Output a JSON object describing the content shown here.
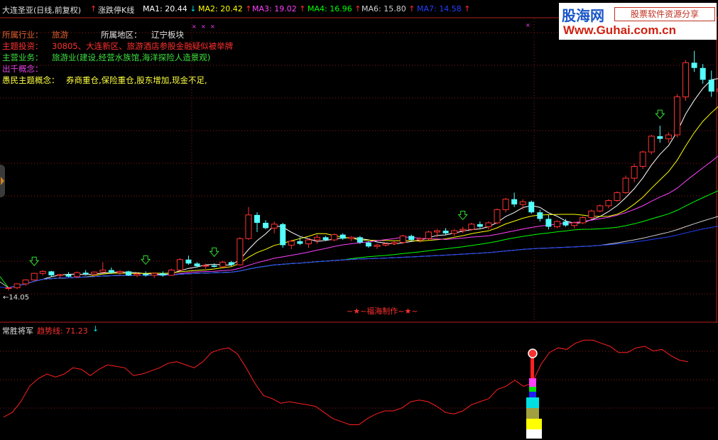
{
  "header": {
    "stock_title": "大连圣亚(日线,前复权)",
    "indicator_name": "涨跌停K线",
    "ma_items": [
      {
        "label": "MA1: 20.44",
        "arrow": "↓",
        "color": "#ffffff",
        "arrow_color": "#00e0e0"
      },
      {
        "label": "MA2: 20.42",
        "arrow": "↑",
        "color": "#ffff00",
        "arrow_color": "#ff3030"
      },
      {
        "label": "MA3: 19.02",
        "arrow": "↑",
        "color": "#ff40ff",
        "arrow_color": "#ff3030"
      },
      {
        "label": "MA4: 16.96",
        "arrow": "↑",
        "color": "#00ff00",
        "arrow_color": "#ff3030"
      },
      {
        "label": "MA6: 15.80",
        "arrow": "↑",
        "color": "#d0d0d0",
        "arrow_color": "#ff3030"
      },
      {
        "label": "MA7: 14.58",
        "arrow": "↑",
        "color": "#2040ff",
        "arrow_color": "#ff3030"
      }
    ]
  },
  "info": {
    "industry_label": "所属行业：",
    "industry_value": "旅游",
    "region_label": "所属地区：",
    "region_value": "辽宁板块",
    "theme_label": "主题投资：",
    "theme_value": "30805、大连新区、旅游酒店参股金融疑似被举牌",
    "business_label": "主营业务：",
    "business_value": "旅游业(建设,经营水族馆,海洋探险人造景观)",
    "concept_label": "出千概念：",
    "retail_label": "愚民主题概念：",
    "retail_value": "券商重仓,保险重仓,股东增加,现金不足,"
  },
  "low_price_label": "←14.05",
  "watermark": "~★~福海制作~★~",
  "indicator": {
    "name": "常胜将军",
    "trend_label": "趋势线: 71.23",
    "arrow": "↓"
  },
  "logo": {
    "cn": "股海网",
    "slogan": "股票软件资源分享",
    "url": "Www.Guhai.com.cn"
  },
  "colors": {
    "up": "#ff3232",
    "down": "#54ffff",
    "ma1": "#ffffff",
    "ma2": "#ffff00",
    "ma3": "#ff40ff",
    "ma4": "#00ff00",
    "ma6": "#d0d0d0",
    "ma7": "#2040ff",
    "trend": "#ff2020"
  },
  "chart_data": {
    "type": "candlestick",
    "price_low_marker": 14.05,
    "candles": [
      [
        14.2,
        14.3,
        14.05,
        14.25
      ],
      [
        14.25,
        14.6,
        14.15,
        14.55
      ],
      [
        14.55,
        14.9,
        14.4,
        14.85
      ],
      [
        14.85,
        15.4,
        14.8,
        15.35
      ],
      [
        15.35,
        15.6,
        15.2,
        15.5
      ],
      [
        15.5,
        15.55,
        15.1,
        15.2
      ],
      [
        15.2,
        15.3,
        15.0,
        15.25
      ],
      [
        15.25,
        15.45,
        15.05,
        15.1
      ],
      [
        15.1,
        15.5,
        15.0,
        15.4
      ],
      [
        15.4,
        15.6,
        15.2,
        15.3
      ],
      [
        15.3,
        15.5,
        15.1,
        15.45
      ],
      [
        15.45,
        16.2,
        15.4,
        15.6
      ],
      [
        15.6,
        15.8,
        15.3,
        15.4
      ],
      [
        15.4,
        15.6,
        15.2,
        15.5
      ],
      [
        15.5,
        15.55,
        15.15,
        15.2
      ],
      [
        15.2,
        15.4,
        15.05,
        15.3
      ],
      [
        15.3,
        15.5,
        15.1,
        15.2
      ],
      [
        15.2,
        15.4,
        15.0,
        15.35
      ],
      [
        15.35,
        15.5,
        15.1,
        15.2
      ],
      [
        15.2,
        15.7,
        15.15,
        15.6
      ],
      [
        15.6,
        16.5,
        15.5,
        16.4
      ],
      [
        16.4,
        16.7,
        16.0,
        16.1
      ],
      [
        16.1,
        16.2,
        15.8,
        15.9
      ],
      [
        15.9,
        16.1,
        15.7,
        15.95
      ],
      [
        15.95,
        16.1,
        15.8,
        15.85
      ],
      [
        15.85,
        16.3,
        15.8,
        16.2
      ],
      [
        16.2,
        16.3,
        15.9,
        16.0
      ],
      [
        16.0,
        18.1,
        15.95,
        18.0
      ],
      [
        18.0,
        20.4,
        17.9,
        19.8
      ],
      [
        19.8,
        20.0,
        18.5,
        19.2
      ],
      [
        19.2,
        19.4,
        18.7,
        18.8
      ],
      [
        18.8,
        19.3,
        18.4,
        19.1
      ],
      [
        19.1,
        19.2,
        17.3,
        17.5
      ],
      [
        17.5,
        17.9,
        17.2,
        17.8
      ],
      [
        17.8,
        18.1,
        17.5,
        17.6
      ],
      [
        17.6,
        18.0,
        17.3,
        17.9
      ],
      [
        17.9,
        18.3,
        17.6,
        18.1
      ],
      [
        18.1,
        18.2,
        17.8,
        17.9
      ],
      [
        17.9,
        18.4,
        17.8,
        18.3
      ],
      [
        18.3,
        18.4,
        17.9,
        18.0
      ],
      [
        18.0,
        18.2,
        17.8,
        18.1
      ],
      [
        18.1,
        18.2,
        17.6,
        17.7
      ],
      [
        17.7,
        17.8,
        17.3,
        17.4
      ],
      [
        17.4,
        17.6,
        17.2,
        17.5
      ],
      [
        17.5,
        17.7,
        17.4,
        17.6
      ],
      [
        17.6,
        17.8,
        17.5,
        17.7
      ],
      [
        17.7,
        18.3,
        17.6,
        18.2
      ],
      [
        18.2,
        18.3,
        17.8,
        17.9
      ],
      [
        17.9,
        18.1,
        17.7,
        18.0
      ],
      [
        18.0,
        18.6,
        17.9,
        18.5
      ],
      [
        18.5,
        18.7,
        18.1,
        18.6
      ],
      [
        18.6,
        18.8,
        18.3,
        18.4
      ],
      [
        18.4,
        18.7,
        18.2,
        18.6
      ],
      [
        18.6,
        18.9,
        18.4,
        18.7
      ],
      [
        18.7,
        19.2,
        18.6,
        19.1
      ],
      [
        19.1,
        19.3,
        18.8,
        18.9
      ],
      [
        18.9,
        19.3,
        18.7,
        19.2
      ],
      [
        19.2,
        20.3,
        19.1,
        20.2
      ],
      [
        20.2,
        21.1,
        20.0,
        21.0
      ],
      [
        21.0,
        21.5,
        20.4,
        20.6
      ],
      [
        20.6,
        21.0,
        20.2,
        20.8
      ],
      [
        20.8,
        20.9,
        19.9,
        20.0
      ],
      [
        20.0,
        20.2,
        19.3,
        19.5
      ],
      [
        19.5,
        19.8,
        18.7,
        18.9
      ],
      [
        18.9,
        19.4,
        18.8,
        19.3
      ],
      [
        19.3,
        19.5,
        18.9,
        19.0
      ],
      [
        19.0,
        19.3,
        18.8,
        19.2
      ],
      [
        19.2,
        19.7,
        19.1,
        19.6
      ],
      [
        19.6,
        20.2,
        19.5,
        20.1
      ],
      [
        20.1,
        20.6,
        20.0,
        20.5
      ],
      [
        20.5,
        21.0,
        20.3,
        20.9
      ],
      [
        20.9,
        21.6,
        20.8,
        21.5
      ],
      [
        21.5,
        22.8,
        21.4,
        22.6
      ],
      [
        22.6,
        23.7,
        22.3,
        23.5
      ],
      [
        23.5,
        24.7,
        23.3,
        24.6
      ],
      [
        24.6,
        25.9,
        24.4,
        25.8
      ],
      [
        25.8,
        26.6,
        25.3,
        25.6
      ],
      [
        25.6,
        26.1,
        25.3,
        25.9
      ],
      [
        25.9,
        29.0,
        25.7,
        28.8
      ],
      [
        28.8,
        31.6,
        28.5,
        31.4
      ],
      [
        31.4,
        32.3,
        30.7,
        31.0
      ],
      [
        31.0,
        31.3,
        29.8,
        30.1
      ],
      [
        30.1,
        30.8,
        28.8,
        29.2
      ],
      [
        29.2,
        29.6,
        28.6,
        29.4
      ],
      [
        29.4,
        29.6,
        28.3,
        29.0
      ],
      [
        29.0,
        29.7,
        28.8,
        29.3
      ]
    ],
    "trend_values": [
      38,
      41,
      48,
      58,
      63,
      66,
      64,
      66,
      70,
      69,
      65,
      69,
      72,
      71,
      70,
      65,
      66,
      68,
      70,
      73,
      74,
      72,
      70,
      74,
      80,
      82,
      83,
      79,
      70,
      60,
      52,
      50,
      47,
      48,
      47,
      46,
      45,
      41,
      37,
      35,
      33,
      33,
      37,
      40,
      42,
      42,
      44,
      48,
      49,
      48,
      45,
      41,
      40,
      42,
      46,
      48,
      50,
      56,
      58,
      62,
      58,
      60,
      72,
      80,
      83,
      82,
      86,
      88,
      88,
      86,
      84,
      80,
      80,
      83,
      84,
      81,
      82,
      78,
      75,
      74
    ]
  }
}
